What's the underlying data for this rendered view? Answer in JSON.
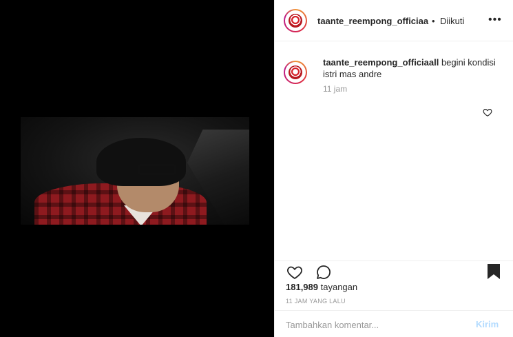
{
  "post": {
    "username": "taante_reempong_officiaa",
    "follow_separator": "•",
    "follow_status": "Diikuti",
    "more_label": "•••"
  },
  "caption": {
    "username": "taante_reempong_officiaall",
    "text": "begini kondisi istri mas andre",
    "time": "11 jam"
  },
  "stats": {
    "views_count": "181,989",
    "views_label": "tayangan",
    "timestamp": "11 JAM YANG LALU"
  },
  "comment_box": {
    "placeholder": "Tambahkan komentar...",
    "post_label": "Kirim"
  },
  "icons": {
    "like": "heart-icon",
    "comment": "comment-icon",
    "save": "bookmark-icon",
    "more": "more-options-icon"
  },
  "colors": {
    "text": "#262626",
    "muted": "#999999",
    "post_button_disabled": "#b3dbff",
    "media_background": "#000000"
  }
}
